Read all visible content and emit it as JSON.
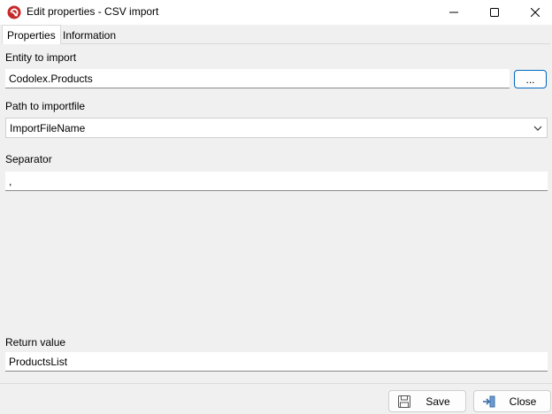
{
  "window": {
    "title": "Edit properties - CSV import",
    "icon": "app-logo-icon",
    "controls": [
      "minimize-icon",
      "maximize-icon",
      "close-icon"
    ]
  },
  "tabs": [
    {
      "label": "Properties",
      "active": true
    },
    {
      "label": "Information",
      "active": false
    }
  ],
  "form": {
    "entity": {
      "label": "Entity to import",
      "value": "Codolex.Products",
      "browse_label": "..."
    },
    "path": {
      "label": "Path to importfile",
      "value": "ImportFileName"
    },
    "separator": {
      "label": "Separator",
      "value": ","
    },
    "return_value": {
      "label": "Return value",
      "value": "ProductsList"
    }
  },
  "footer": {
    "save_label": "Save",
    "close_label": "Close"
  },
  "colors": {
    "accent": "#0067c0",
    "app_icon": "#c62828",
    "background": "#f0f0f0"
  }
}
